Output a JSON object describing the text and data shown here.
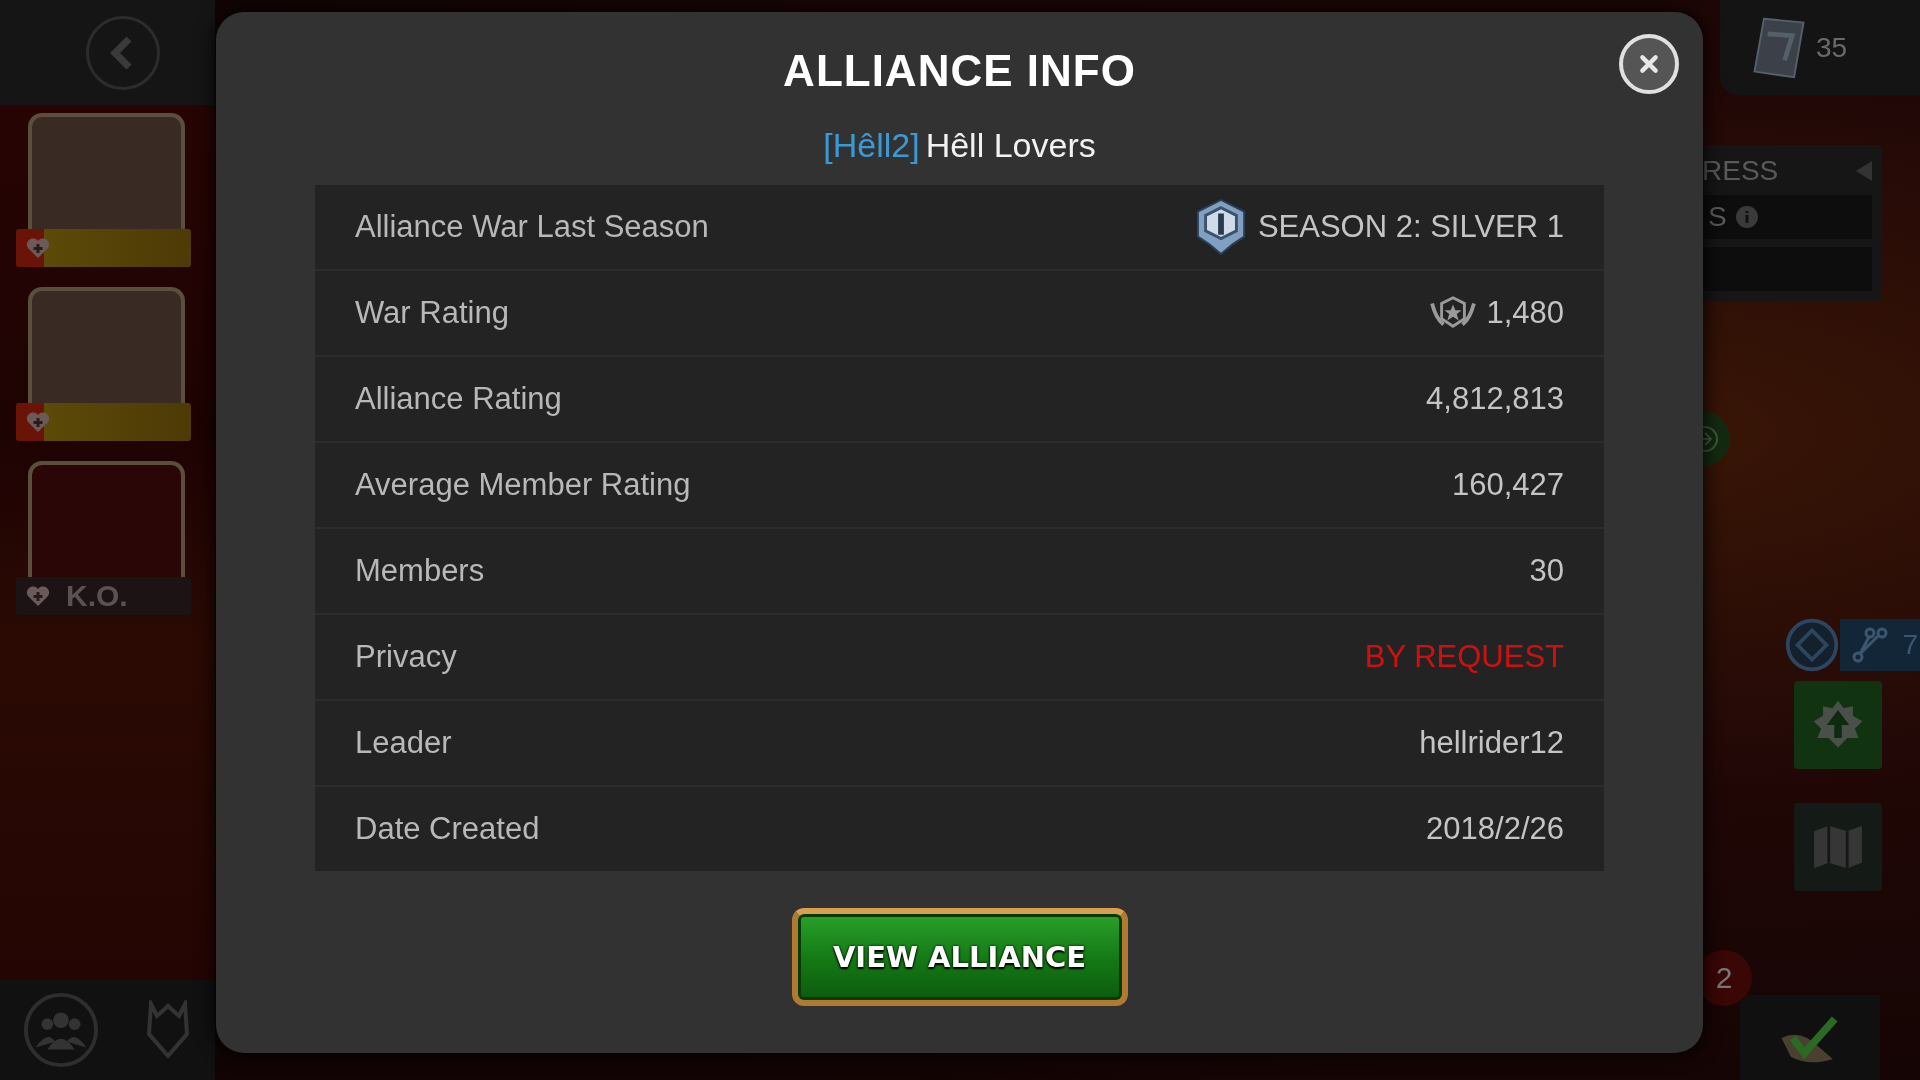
{
  "background": {
    "champions": [
      {
        "knocked_out": false
      },
      {
        "knocked_out": false
      },
      {
        "knocked_out": true,
        "status": "K.O."
      }
    ],
    "currency": {
      "count": "35"
    },
    "progress_panel": {
      "title": "RESS",
      "label": "S"
    },
    "tab_fragment": "7",
    "quests_badge": "2"
  },
  "dialog": {
    "title": "ALLIANCE INFO",
    "tag": "[Hêll2]",
    "name": "Hêll Lovers",
    "rows": [
      {
        "label": "Alliance War Last Season",
        "value": "SEASON 2: SILVER 1",
        "kind": "season"
      },
      {
        "label": "War Rating",
        "value": "1,480",
        "kind": "war"
      },
      {
        "label": "Alliance Rating",
        "value": "4,812,813",
        "kind": "plain"
      },
      {
        "label": "Average Member Rating",
        "value": "160,427",
        "kind": "plain"
      },
      {
        "label": "Members",
        "value": "30",
        "kind": "plain"
      },
      {
        "label": "Privacy",
        "value": "BY REQUEST",
        "kind": "alert"
      },
      {
        "label": "Leader",
        "value": "hellrider12",
        "kind": "plain"
      },
      {
        "label": "Date Created",
        "value": "2018/2/26",
        "kind": "plain"
      }
    ],
    "button": "VIEW ALLIANCE"
  }
}
